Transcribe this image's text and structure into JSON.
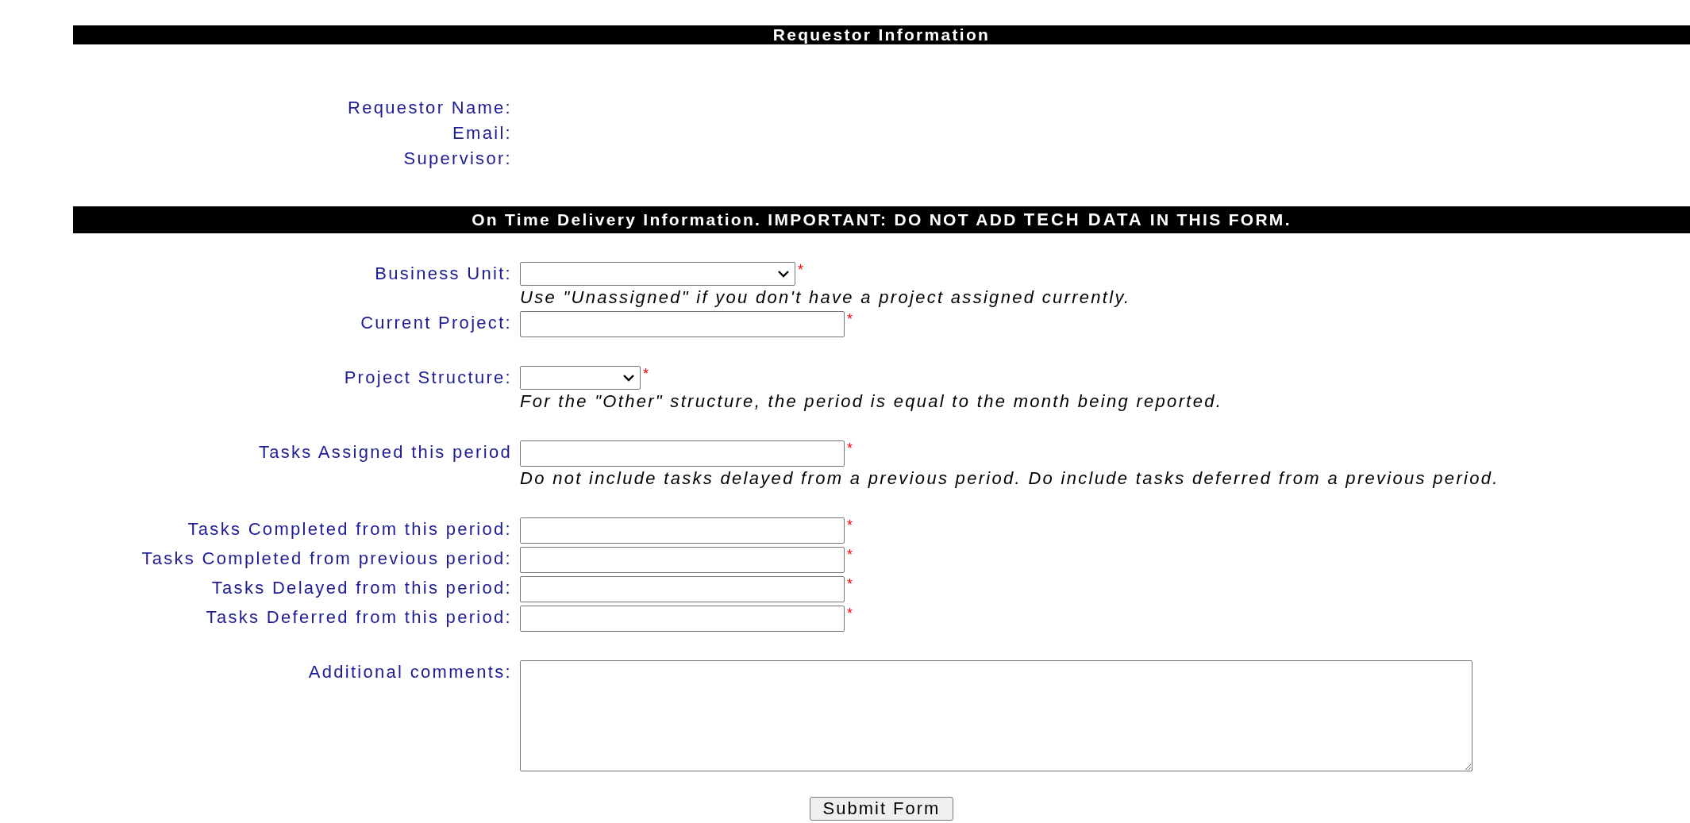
{
  "sections": [
    {
      "title": "Requestor Information",
      "kind": "info",
      "labels": [
        "Requestor Name:",
        "Email:",
        "Supervisor:"
      ]
    },
    {
      "title": "On Time Delivery Information. IMPORTANT: DO NOT ADD **TECH DATA** IN THIS FORM.",
      "kind": "form",
      "groups": [
        [
          {
            "label": "Business Unit:",
            "kind": "select",
            "required_mark": "*",
            "hint": "Use \"Unassigned\" if you don't have a project assigned currently."
          },
          {
            "label": "Current Project:",
            "kind": "input",
            "required_mark": "*"
          }
        ],
        [
          {
            "label": "Project Structure:",
            "kind": "miniselect",
            "required_mark": "*",
            "hint": "For the \"Other\" structure, the period is equal to the month being reported."
          }
        ],
        [
          {
            "label": "Tasks Assigned this period",
            "kind": "input",
            "required_mark": "*",
            "hint": "Do not include tasks delayed from a previous period. Do include tasks deferred from a previous period."
          }
        ],
        [
          {
            "label": "Tasks Completed from this period:",
            "kind": "input",
            "required_mark": "*"
          },
          {
            "label": "Tasks Completed from previous period:",
            "kind": "input",
            "required_mark": "*"
          },
          {
            "label": "Tasks Delayed from this period:",
            "kind": "input",
            "required_mark": "*"
          },
          {
            "label": "Tasks Deferred from this period:",
            "kind": "input",
            "required_mark": "*"
          }
        ],
        [
          {
            "label": "Additional comments:",
            "kind": "textarea"
          }
        ]
      ]
    }
  ],
  "submit": "Submit Form"
}
